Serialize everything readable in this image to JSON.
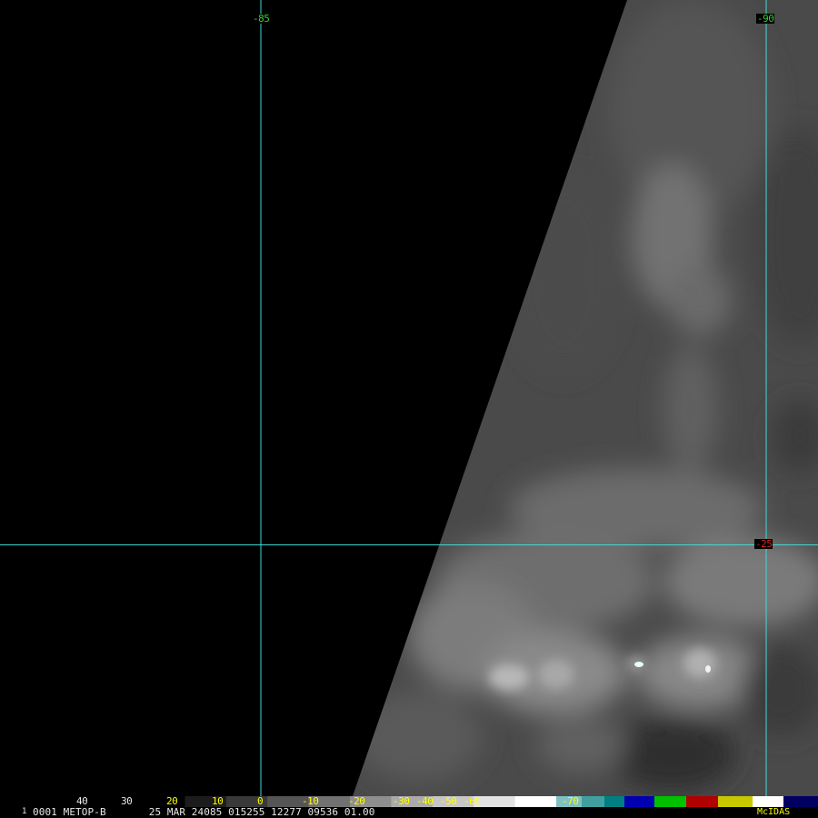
{
  "image": {
    "satellite": "METOP-B",
    "frame": "1",
    "info_line": "0001 METOP-B       25 MAR 24085 015255 12277 09536 01.00",
    "software": "McIDAS"
  },
  "grid": {
    "longitude_labels": [
      "-85",
      "-90"
    ],
    "latitude_labels": [
      "-25"
    ],
    "line_color": "#40d8d8",
    "longitude_label_color": "#32d232",
    "latitude_label_color": "#e02020"
  },
  "temperature_scale": {
    "ticks": [
      {
        "text": "40",
        "color": "#e8e8e8"
      },
      {
        "text": "30",
        "color": "#e8e8e8"
      },
      {
        "text": "20",
        "color": "#ffff00"
      },
      {
        "text": "10",
        "color": "#ffff00"
      },
      {
        "text": "0",
        "color": "#ffff00"
      },
      {
        "text": "-10",
        "color": "#ffff00"
      },
      {
        "text": "-20",
        "color": "#ffff00"
      },
      {
        "text": "-30",
        "color": "#ffff00"
      },
      {
        "text": "-40",
        "color": "#ffff00"
      },
      {
        "text": "-50",
        "color": "#ffff00"
      },
      {
        "text": "-60",
        "color": "#ffff00"
      },
      {
        "text": "-70",
        "color": "#ffff00"
      }
    ],
    "color_segments": [
      "#000000",
      "#1a1a1a",
      "#333333",
      "#4d4d4d",
      "#666666",
      "#808080",
      "#999999",
      "#b3b3b3",
      "#cccccc",
      "#e6e6e6",
      "#ffffff",
      "#80c0c0",
      "#40a0a0",
      "#008080",
      "#0000b0",
      "#00c000",
      "#b00000",
      "#c8c800",
      "#ffffff",
      "#000060"
    ]
  }
}
